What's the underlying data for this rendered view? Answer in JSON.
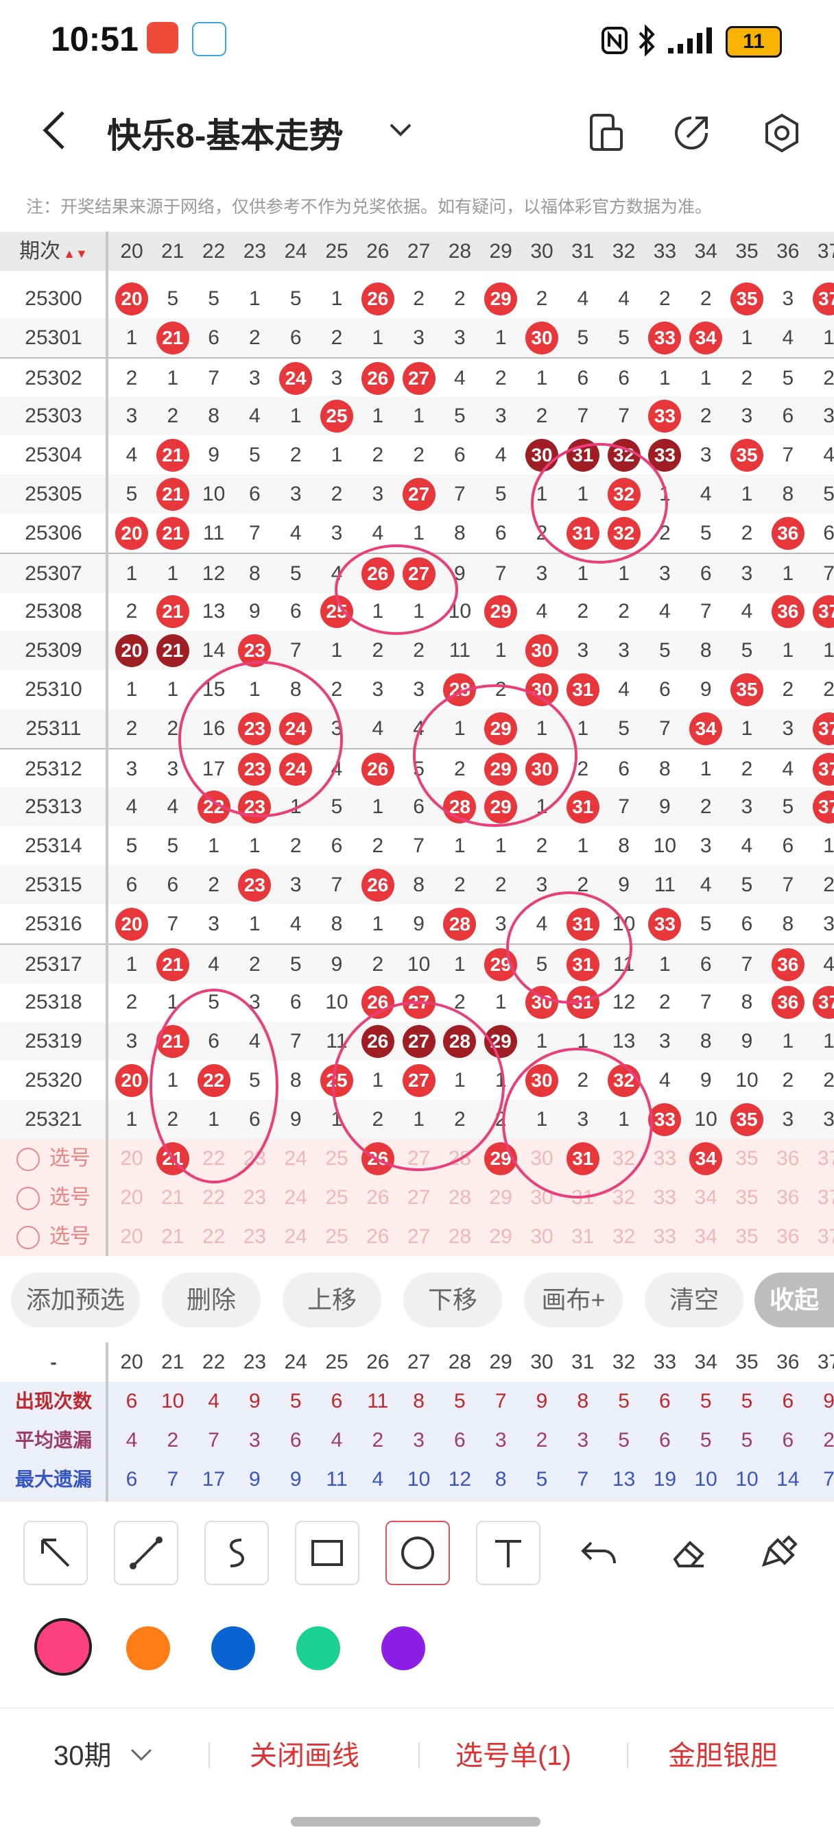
{
  "status_bar": {
    "time": "10:51",
    "battery": "11"
  },
  "header": {
    "title": "快乐8-基本走势"
  },
  "notice": "注：开奖结果来源于网络，仅供参考不作为兑奖依据。如有疑问，以福体彩官方数据为准。",
  "grid": {
    "period_header": "期次",
    "columns": [
      20,
      21,
      22,
      23,
      24,
      25,
      26,
      27,
      28,
      29,
      30,
      31,
      32,
      33,
      34,
      35,
      36,
      37
    ],
    "rows": [
      {
        "period": "25300",
        "cells": [
          "20",
          "5",
          "5",
          "1",
          "5",
          "1",
          "26",
          "2",
          "2",
          "29",
          "2",
          "4",
          "4",
          "2",
          "2",
          "35",
          "3",
          "37"
        ],
        "dark": []
      },
      {
        "period": "25301",
        "cells": [
          "1",
          "21",
          "6",
          "2",
          "6",
          "2",
          "1",
          "3",
          "3",
          "1",
          "30",
          "5",
          "5",
          "33",
          "34",
          "1",
          "4",
          "1"
        ],
        "dark": []
      },
      {
        "period": "25302",
        "cells": [
          "2",
          "1",
          "7",
          "3",
          "24",
          "3",
          "26",
          "27",
          "4",
          "2",
          "1",
          "6",
          "6",
          "1",
          "1",
          "2",
          "5",
          "2"
        ],
        "dark": []
      },
      {
        "period": "25303",
        "cells": [
          "3",
          "2",
          "8",
          "4",
          "1",
          "25",
          "1",
          "1",
          "5",
          "3",
          "2",
          "7",
          "7",
          "33",
          "2",
          "3",
          "6",
          "3"
        ],
        "dark": []
      },
      {
        "period": "25304",
        "cells": [
          "4",
          "21",
          "9",
          "5",
          "2",
          "1",
          "2",
          "2",
          "6",
          "4",
          "30",
          "31",
          "32",
          "33",
          "3",
          "35",
          "7",
          "4"
        ],
        "dark": [
          "30",
          "31",
          "32",
          "33"
        ]
      },
      {
        "period": "25305",
        "cells": [
          "5",
          "21",
          "10",
          "6",
          "3",
          "2",
          "3",
          "27",
          "7",
          "5",
          "1",
          "1",
          "32",
          "1",
          "4",
          "1",
          "8",
          "5"
        ],
        "dark": []
      },
      {
        "period": "25306",
        "cells": [
          "20",
          "21",
          "11",
          "7",
          "4",
          "3",
          "4",
          "1",
          "8",
          "6",
          "2",
          "31",
          "32",
          "2",
          "5",
          "2",
          "36",
          "6"
        ],
        "dark": []
      },
      {
        "period": "25307",
        "cells": [
          "1",
          "1",
          "12",
          "8",
          "5",
          "4",
          "26",
          "27",
          "9",
          "7",
          "3",
          "1",
          "1",
          "3",
          "6",
          "3",
          "1",
          "7"
        ],
        "dark": []
      },
      {
        "period": "25308",
        "cells": [
          "2",
          "21",
          "13",
          "9",
          "6",
          "25",
          "1",
          "1",
          "10",
          "29",
          "4",
          "2",
          "2",
          "4",
          "7",
          "4",
          "36",
          "37"
        ],
        "dark": []
      },
      {
        "period": "25309",
        "cells": [
          "20",
          "21",
          "14",
          "23",
          "7",
          "1",
          "2",
          "2",
          "11",
          "1",
          "30",
          "3",
          "3",
          "5",
          "8",
          "5",
          "1",
          "1"
        ],
        "dark": [
          "20",
          "21"
        ]
      },
      {
        "period": "25310",
        "cells": [
          "1",
          "1",
          "15",
          "1",
          "8",
          "2",
          "3",
          "3",
          "28",
          "2",
          "30",
          "31",
          "4",
          "6",
          "9",
          "35",
          "2",
          "2"
        ],
        "dark": []
      },
      {
        "period": "25311",
        "cells": [
          "2",
          "2",
          "16",
          "23",
          "24",
          "3",
          "4",
          "4",
          "1",
          "29",
          "1",
          "1",
          "5",
          "7",
          "34",
          "1",
          "3",
          "37"
        ],
        "dark": []
      },
      {
        "period": "25312",
        "cells": [
          "3",
          "3",
          "17",
          "23",
          "24",
          "4",
          "26",
          "5",
          "2",
          "29",
          "30",
          "2",
          "6",
          "8",
          "1",
          "2",
          "4",
          "37"
        ],
        "dark": []
      },
      {
        "period": "25313",
        "cells": [
          "4",
          "4",
          "22",
          "23",
          "1",
          "5",
          "1",
          "6",
          "28",
          "29",
          "1",
          "31",
          "7",
          "9",
          "2",
          "3",
          "5",
          "37"
        ],
        "dark": []
      },
      {
        "period": "25314",
        "cells": [
          "5",
          "5",
          "1",
          "1",
          "2",
          "6",
          "2",
          "7",
          "1",
          "1",
          "2",
          "1",
          "8",
          "10",
          "3",
          "4",
          "6",
          "1"
        ],
        "dark": []
      },
      {
        "period": "25315",
        "cells": [
          "6",
          "6",
          "2",
          "23",
          "3",
          "7",
          "26",
          "8",
          "2",
          "2",
          "3",
          "2",
          "9",
          "11",
          "4",
          "5",
          "7",
          "2"
        ],
        "dark": []
      },
      {
        "period": "25316",
        "cells": [
          "20",
          "7",
          "3",
          "1",
          "4",
          "8",
          "1",
          "9",
          "28",
          "3",
          "4",
          "31",
          "10",
          "33",
          "5",
          "6",
          "8",
          "3"
        ],
        "dark": []
      },
      {
        "period": "25317",
        "cells": [
          "1",
          "21",
          "4",
          "2",
          "5",
          "9",
          "2",
          "10",
          "1",
          "29",
          "5",
          "31",
          "11",
          "1",
          "6",
          "7",
          "36",
          "4"
        ],
        "dark": []
      },
      {
        "period": "25318",
        "cells": [
          "2",
          "1",
          "5",
          "3",
          "6",
          "10",
          "26",
          "27",
          "2",
          "1",
          "30",
          "31",
          "12",
          "2",
          "7",
          "8",
          "36",
          "37"
        ],
        "dark": []
      },
      {
        "period": "25319",
        "cells": [
          "3",
          "21",
          "6",
          "4",
          "7",
          "11",
          "26",
          "27",
          "28",
          "29",
          "1",
          "1",
          "13",
          "3",
          "8",
          "9",
          "1",
          "1"
        ],
        "dark": [
          "26",
          "27",
          "28",
          "29"
        ]
      },
      {
        "period": "25320",
        "cells": [
          "20",
          "1",
          "22",
          "5",
          "8",
          "25",
          "1",
          "27",
          "1",
          "1",
          "30",
          "2",
          "32",
          "4",
          "9",
          "10",
          "2",
          "2"
        ],
        "dark": []
      },
      {
        "period": "25321",
        "cells": [
          "1",
          "2",
          "1",
          "6",
          "9",
          "1",
          "2",
          "1",
          "2",
          "2",
          "1",
          "3",
          "1",
          "33",
          "10",
          "35",
          "3",
          "3"
        ],
        "dark": []
      }
    ],
    "select_rows": [
      {
        "label": "选号",
        "cells": [
          "20",
          "21",
          "22",
          "23",
          "24",
          "25",
          "26",
          "27",
          "28",
          "29",
          "30",
          "31",
          "32",
          "33",
          "34",
          "35",
          "36",
          "37"
        ],
        "picked": [
          "21",
          "26",
          "29",
          "31",
          "34"
        ]
      },
      {
        "label": "选号",
        "cells": [
          "20",
          "21",
          "22",
          "23",
          "24",
          "25",
          "26",
          "27",
          "28",
          "29",
          "30",
          "31",
          "32",
          "33",
          "34",
          "35",
          "36",
          "37"
        ],
        "picked": []
      },
      {
        "label": "选号",
        "cells": [
          "20",
          "21",
          "22",
          "23",
          "24",
          "25",
          "26",
          "27",
          "28",
          "29",
          "30",
          "31",
          "32",
          "33",
          "34",
          "35",
          "36",
          "37"
        ],
        "picked": []
      }
    ]
  },
  "toolbar": {
    "add_preselect": "添加预选",
    "delete": "删除",
    "move_up": "上移",
    "move_down": "下移",
    "canvas": "画布+",
    "clear": "清空",
    "collapse": "收起"
  },
  "stats": {
    "header_label": "-",
    "rows": [
      {
        "label": "出现次数",
        "values": [
          "6",
          "10",
          "4",
          "9",
          "5",
          "6",
          "11",
          "8",
          "5",
          "7",
          "9",
          "8",
          "5",
          "6",
          "5",
          "5",
          "6",
          "9"
        ],
        "color": "#c0272d"
      },
      {
        "label": "平均遗漏",
        "values": [
          "4",
          "2",
          "7",
          "3",
          "6",
          "4",
          "2",
          "3",
          "6",
          "3",
          "2",
          "3",
          "5",
          "6",
          "5",
          "5",
          "6",
          "2"
        ],
        "color": "#9c3d66"
      },
      {
        "label": "最大遗漏",
        "values": [
          "6",
          "7",
          "17",
          "9",
          "9",
          "11",
          "4",
          "10",
          "12",
          "8",
          "5",
          "7",
          "13",
          "19",
          "10",
          "10",
          "14",
          "7"
        ],
        "color": "#3556c4"
      }
    ]
  },
  "drawing_tools": [
    "arrow-tool",
    "line-tool",
    "freehand-tool",
    "rectangle-tool",
    "circle-tool",
    "text-tool",
    "undo-tool",
    "eraser-tool",
    "clear-brush-tool"
  ],
  "colors": [
    "#ff4080",
    "#ff7c14",
    "#0a64d2",
    "#19d191",
    "#8c1ee6"
  ],
  "bottom_bar": {
    "period_select": "30期",
    "close_lines": "关闭画线",
    "pick_list": "选号单(1)",
    "golden_bold": "金胆银胆"
  }
}
